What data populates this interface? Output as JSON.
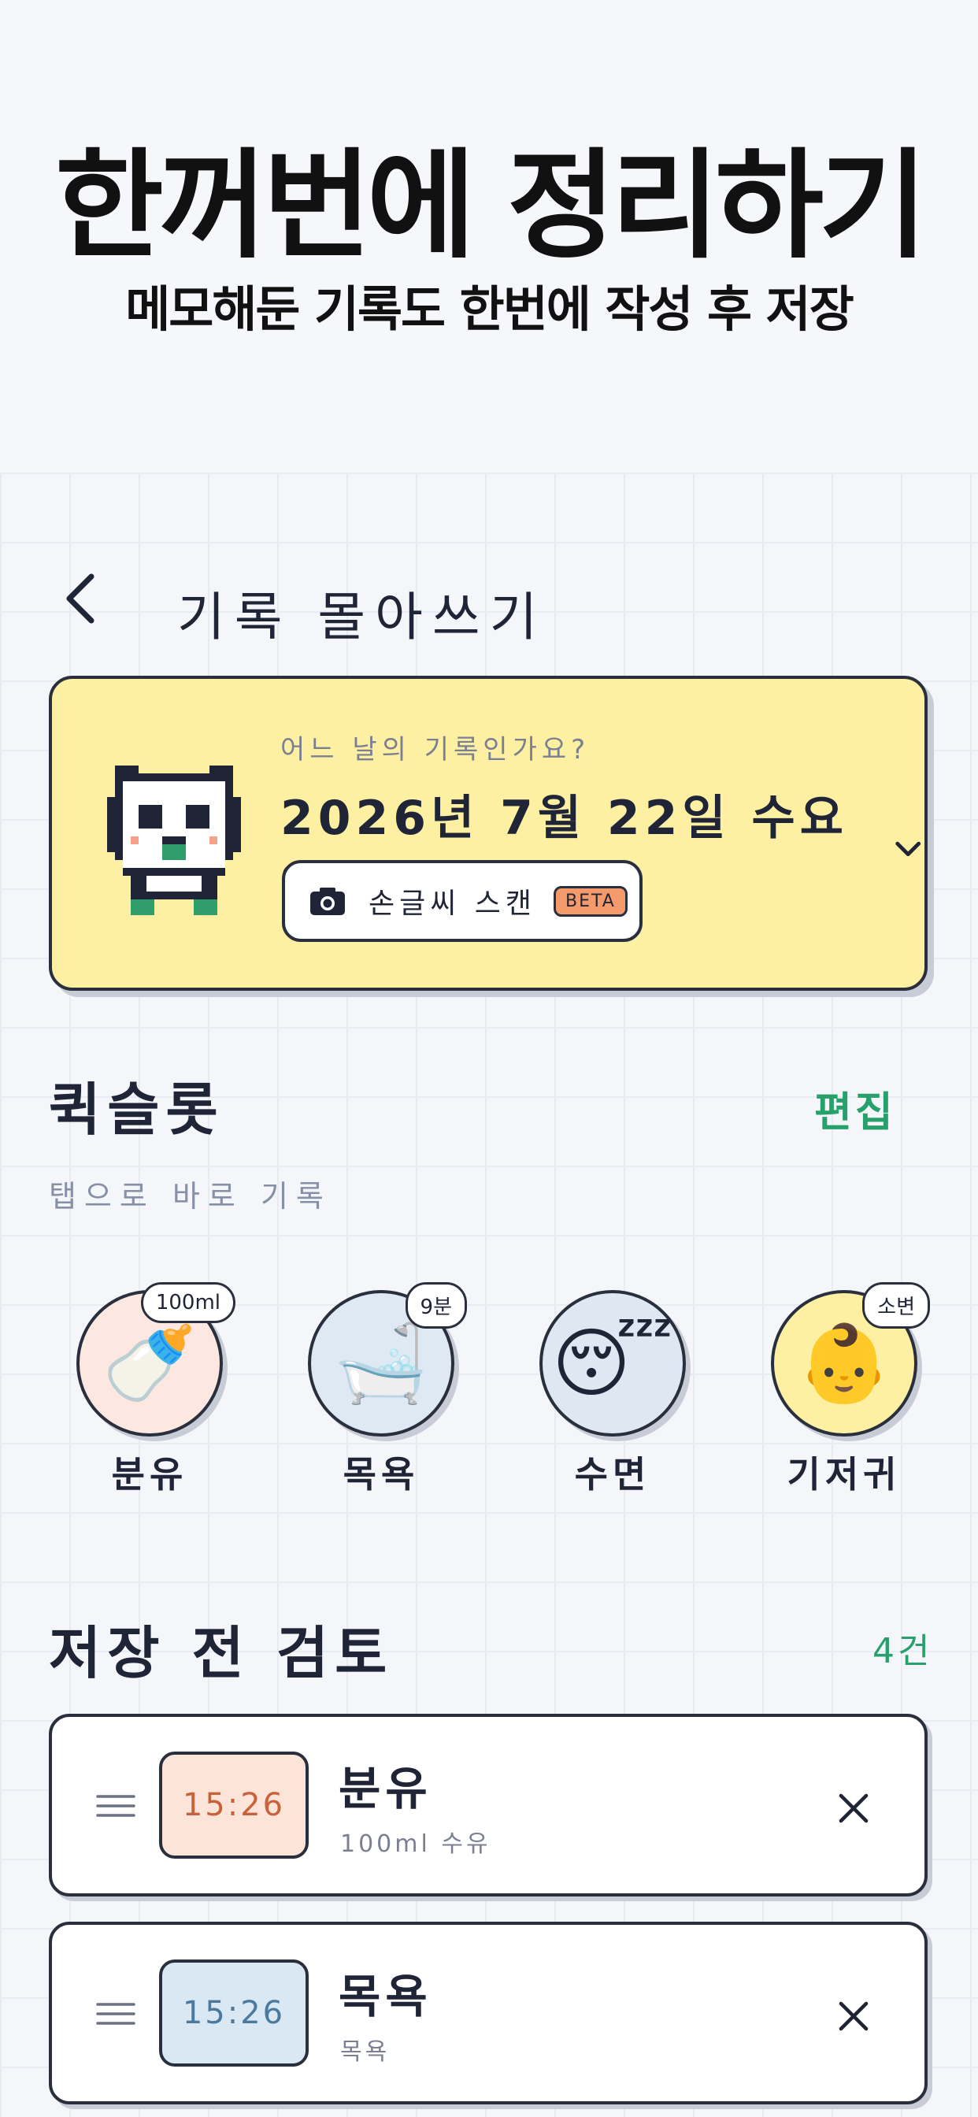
{
  "promo": {
    "title": "한꺼번에 정리하기",
    "subtitle": "메모해둔 기록도 한번에 작성 후 저장"
  },
  "header": {
    "back_icon": "chevron-left-icon",
    "title": "기록 몰아쓰기"
  },
  "date_card": {
    "question": "어느 날의 기록인가요?",
    "date": "2026년 7월 22일 수요일",
    "scan_label": "손글씨 스캔",
    "scan_badge": "BETA",
    "bg_color": "#fdf0a2"
  },
  "quick_slot": {
    "title": "퀵슬롯",
    "edit_label": "편집",
    "subtitle": "탭으로 바로 기록",
    "items": [
      {
        "label": "분유",
        "badge": "100ml",
        "icon": "baby-bottle-icon",
        "emoji": "🍼",
        "bg": "#fde8e1"
      },
      {
        "label": "목욕",
        "badge": "9분",
        "icon": "bathtub-icon",
        "emoji": "🛁",
        "bg": "#dfe9f3"
      },
      {
        "label": "수면",
        "badge": "",
        "icon": "sleeping-face-icon",
        "emoji": "😴",
        "bg": "#dfe7f3"
      },
      {
        "label": "기저귀",
        "badge": "소변",
        "icon": "baby-face-icon",
        "emoji": "👶",
        "bg": "#fdf0a2"
      }
    ]
  },
  "review": {
    "title": "저장 전 검토",
    "count": "4건",
    "items": [
      {
        "time": "15:26",
        "title": "분유",
        "desc": "100ml 수유",
        "time_bg": "#fde4d8",
        "time_color": "#c8623a"
      },
      {
        "time": "15:26",
        "title": "목욕",
        "desc": "목욕",
        "time_bg": "#d9e8f2",
        "time_color": "#4a7aa0"
      }
    ]
  },
  "colors": {
    "accent_green": "#28a06b",
    "ink": "#1f2436"
  }
}
